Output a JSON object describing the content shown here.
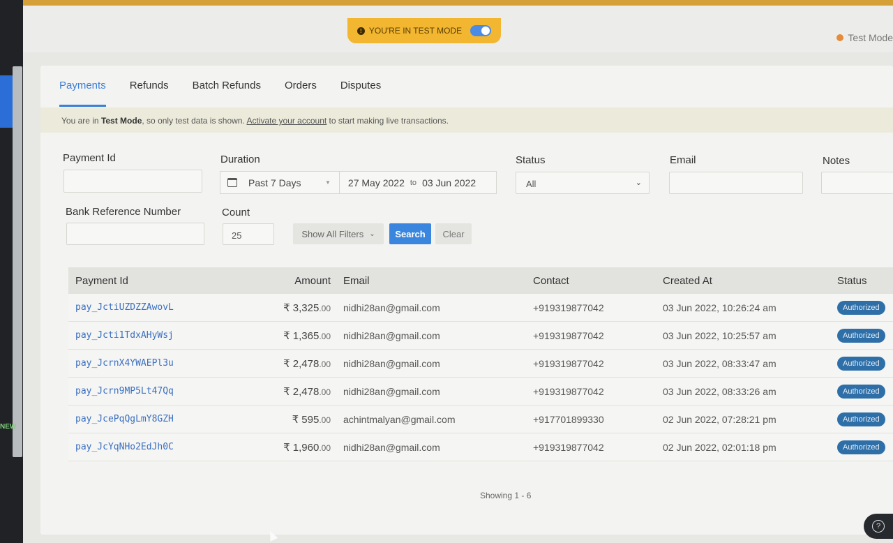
{
  "left_rail": {
    "new_badge": "NEW"
  },
  "topbar": {
    "test_mode_label": "YOU'RE IN TEST MODE",
    "test_mode_toggle_on": true,
    "account_status": "Test Mode"
  },
  "tabs": [
    {
      "label": "Payments",
      "active": true
    },
    {
      "label": "Refunds"
    },
    {
      "label": "Batch Refunds"
    },
    {
      "label": "Orders"
    },
    {
      "label": "Disputes"
    }
  ],
  "banner": {
    "prefix": "You are in ",
    "mode": "Test Mode",
    "middle": ", so only test data is shown. ",
    "link": "Activate your account",
    "suffix": " to start making live transactions."
  },
  "filters": {
    "payment_id_label": "Payment Id",
    "payment_id_value": "",
    "duration_label": "Duration",
    "duration_preset": "Past 7 Days",
    "date_from": "27 May 2022",
    "date_to_sep": "to",
    "date_to": "03 Jun 2022",
    "status_label": "Status",
    "status_value": "All",
    "email_label": "Email",
    "email_value": "",
    "notes_label": "Notes",
    "bank_ref_label": "Bank Reference Number",
    "bank_ref_value": "",
    "count_label": "Count",
    "count_value": "25",
    "show_filters": "Show All Filters",
    "search": "Search",
    "clear": "Clear"
  },
  "table": {
    "headers": {
      "payment_id": "Payment Id",
      "amount": "Amount",
      "email": "Email",
      "contact": "Contact",
      "created_at": "Created At",
      "status": "Status"
    },
    "rows": [
      {
        "id": "pay_JctiUZDZZAwovL",
        "amount": "₹ 3,325",
        "decimals": ".00",
        "email": "nidhi28an@gmail.com",
        "contact": "+919319877042",
        "created": "03 Jun 2022, 10:26:24 am",
        "status": "Authorized"
      },
      {
        "id": "pay_Jcti1TdxAHyWsj",
        "amount": "₹ 1,365",
        "decimals": ".00",
        "email": "nidhi28an@gmail.com",
        "contact": "+919319877042",
        "created": "03 Jun 2022, 10:25:57 am",
        "status": "Authorized"
      },
      {
        "id": "pay_JcrnX4YWAEPl3u",
        "amount": "₹ 2,478",
        "decimals": ".00",
        "email": "nidhi28an@gmail.com",
        "contact": "+919319877042",
        "created": "03 Jun 2022, 08:33:47 am",
        "status": "Authorized"
      },
      {
        "id": "pay_Jcrn9MP5Lt47Qq",
        "amount": "₹ 2,478",
        "decimals": ".00",
        "email": "nidhi28an@gmail.com",
        "contact": "+919319877042",
        "created": "03 Jun 2022, 08:33:26 am",
        "status": "Authorized"
      },
      {
        "id": "pay_JcePqQgLmY8GZH",
        "amount": "₹ 595",
        "decimals": ".00",
        "email": "achintmalyan@gmail.com",
        "contact": "+917701899330",
        "created": "02 Jun 2022, 07:28:21 pm",
        "status": "Authorized"
      },
      {
        "id": "pay_JcYqNHo2EdJh0C",
        "amount": "₹ 1,960",
        "decimals": ".00",
        "email": "nidhi28an@gmail.com",
        "contact": "+919319877042",
        "created": "02 Jun 2022, 02:01:18 pm",
        "status": "Authorized"
      }
    ]
  },
  "pagination": {
    "showing": "Showing 1 - 6"
  },
  "help_icon": "question-icon"
}
